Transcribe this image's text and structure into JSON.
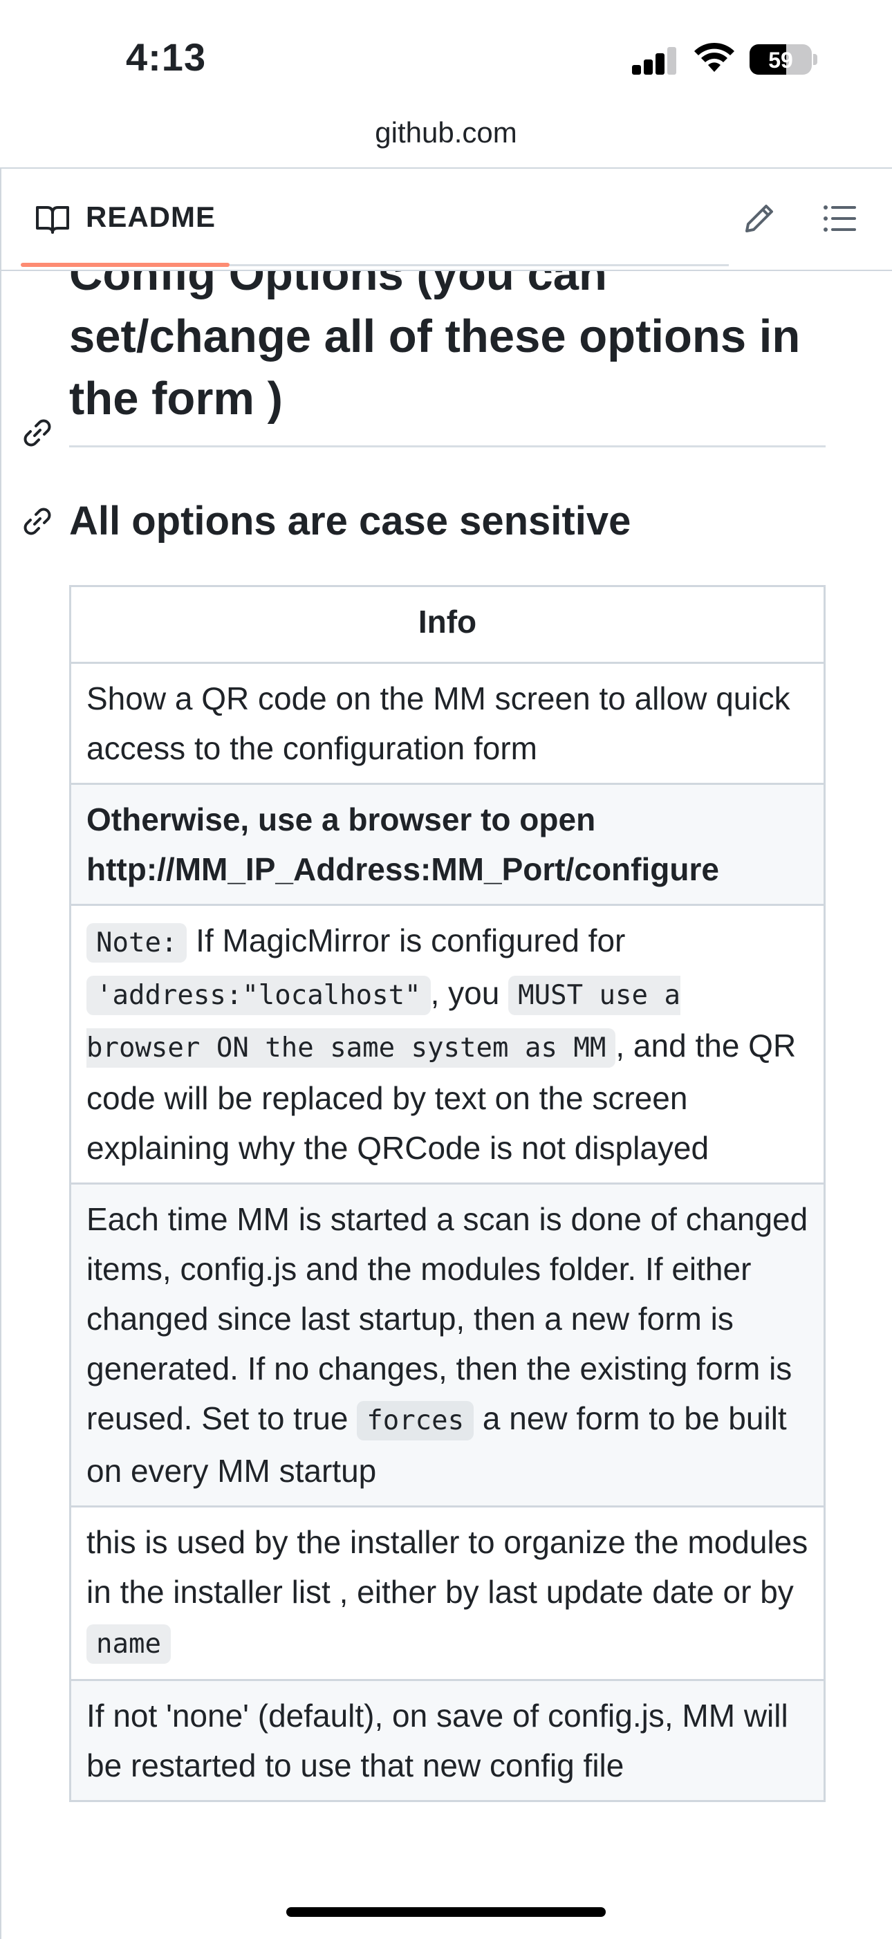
{
  "status_bar": {
    "time": "4:13",
    "battery_percent": "59",
    "battery_level": 0.59,
    "signal_bars": 3
  },
  "browser": {
    "url": "github.com"
  },
  "readme": {
    "tab_label": "README",
    "icons": [
      "book-icon",
      "pencil-icon",
      "list-icon"
    ],
    "heading_1": "Config Options (you can set/change all of these options in the form )",
    "heading_2": "All options are case sensitive",
    "table": {
      "header": "Info",
      "rows": [
        {
          "text": "Show a QR code on the MM screen to allow quick access to the configuration form"
        },
        {
          "text": "Otherwise, use a browser to open http://MM_IP_Address:MM_Port/configure",
          "bold": true
        },
        {
          "note_code": "Note:",
          "text_1": " If MagicMirror is configured for ",
          "address_code": "'address:\"localhost\"",
          "text_2": ", you ",
          "must_code": "MUST use a browser ON the same system as MM",
          "text_3": ", and the QR code will be replaced by text on the screen explaining why the QRCode is not displayed"
        },
        {
          "text_1": "Each time MM is started a scan is done of changed items, config.js and the modules folder. If either changed since last startup, then a new form is generated. If no changes, then the existing form is reused. Set to true ",
          "forces_code": "forces",
          "text_2": " a new form to be built on every MM startup"
        },
        {
          "text_1": "this is used by the installer to organize the modules in the installer list , either by last update date or by ",
          "name_code": "name"
        },
        {
          "text": "If not 'none' (default), on save of config.js, MM will be restarted to use that new config file"
        }
      ]
    }
  },
  "colors": {
    "tab_underline": "#fd8c73",
    "border": "#d0d7de",
    "alt_row": "#f6f8fa",
    "text": "#1f2328"
  }
}
